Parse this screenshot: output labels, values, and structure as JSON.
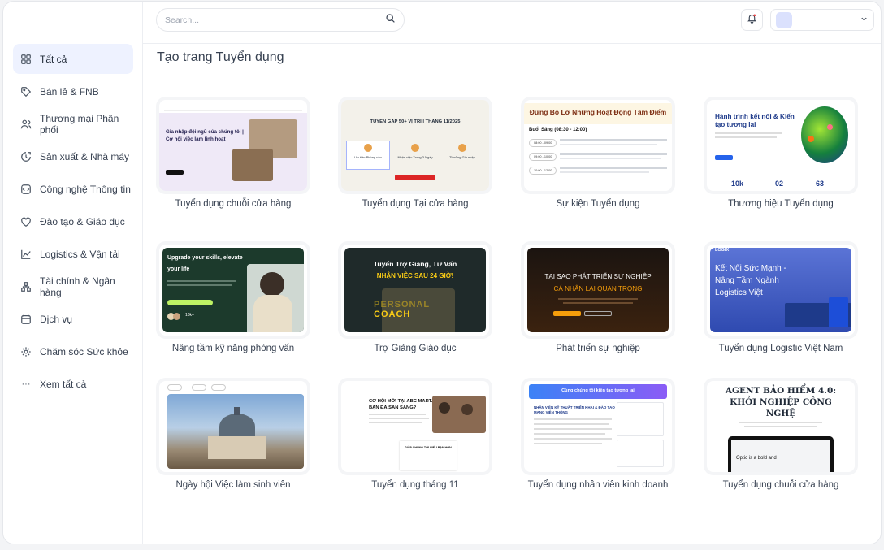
{
  "search": {
    "placeholder": "Search..."
  },
  "sidebar": {
    "items": [
      {
        "label": "Tất cả",
        "icon": "grid-icon",
        "active": true
      },
      {
        "label": "Bán lẻ & FNB",
        "icon": "tag-icon"
      },
      {
        "label": "Thương mại Phân phối",
        "icon": "users-icon"
      },
      {
        "label": "Sản xuất & Nhà máy",
        "icon": "factory-icon"
      },
      {
        "label": "Công nghệ Thông tin",
        "icon": "code-icon"
      },
      {
        "label": "Đào tạo & Giáo dục",
        "icon": "education-icon"
      },
      {
        "label": "Logistics & Vận tải",
        "icon": "chart-icon"
      },
      {
        "label": "Tài chính & Ngân hàng",
        "icon": "bank-icon"
      },
      {
        "label": "Dịch vụ",
        "icon": "calendar-icon"
      },
      {
        "label": "Chăm sóc Sức khỏe",
        "icon": "health-icon"
      },
      {
        "label": "Xem tất cả",
        "icon": "more-icon"
      }
    ]
  },
  "page": {
    "title": "Tạo trang Tuyển dụng"
  },
  "templates": [
    {
      "label": "Tuyển dụng chuỗi cửa hàng",
      "thumb": {
        "bg": "#ffffff",
        "lines": [
          "Gia nhập đội ngũ của chúng tôi |",
          "Cơ hội việc làm linh hoạt"
        ]
      }
    },
    {
      "label": "Tuyển dụng Tại cửa hàng",
      "thumb": {
        "bg": "#f3f1ea",
        "lines": [
          "TUYỂN GẤP 50+ VỊ TRÍ | THÁNG 11/2025",
          "Ưu tiên Phòng vân",
          "Nhận việc Trong 3 Ngày",
          "Thưởng Gia nhập"
        ]
      }
    },
    {
      "label": "Sự kiện Tuyển dụng",
      "thumb": {
        "bg": "#ffffff",
        "lines": [
          "Đừng Bỏ Lỡ Những Hoạt Động Tâm Điểm",
          "Buổi Sáng (08:30 - 12:00)",
          "08:00 - 09:00",
          "09:00 - 10:00",
          "10:00 - 12:00"
        ]
      }
    },
    {
      "label": "Thương hiệu Tuyển dụng",
      "thumb": {
        "bg": "#ffffff",
        "lines": [
          "Hành trình kết nối & Kiến",
          "tạo tương lai",
          "10k",
          "02",
          "63"
        ]
      }
    },
    {
      "label": "Nâng tầm kỹ năng phỏng vấn",
      "thumb": {
        "bg": "#1c3a2c",
        "lines": [
          "Upgrade your skills, elevate",
          "your life",
          "10k+"
        ]
      }
    },
    {
      "label": "Trợ Giảng Giáo dục",
      "thumb": {
        "bg": "#1f2a2a",
        "lines": [
          "Tuyển Trợ Giảng, Tư Vấn",
          "NHẬN VIỆC SAU 24 GIỜ!",
          "PERSONAL",
          "COACH"
        ]
      }
    },
    {
      "label": "Phát triển sự nghiệp",
      "thumb": {
        "bg": "#1b1410",
        "lines": [
          "TẠI SAO PHÁT TRIỂN SỰ NGHIỆP",
          "CÁ NHÂN LẠI QUAN TRỌNG"
        ]
      }
    },
    {
      "label": "Tuyển dụng Logistic Việt Nam",
      "thumb": {
        "bg": "#3f5cc9",
        "lines": [
          "Kết Nối Sức Mạnh -",
          "Nâng Tầm Ngành",
          "Logistics Việt",
          "LOGIX"
        ]
      }
    },
    {
      "label": "Ngày hội Việc làm sinh viên",
      "thumb": {
        "bg": "#8fb3d9",
        "lines": []
      }
    },
    {
      "label": "Tuyển dụng tháng 11",
      "thumb": {
        "bg": "#ffffff",
        "lines": [
          "CƠ HỘI MỚI TẠI ABC MART.",
          "BẠN ĐÃ SẴN SÀNG?",
          "GIẢP CHUNG TỚI HIẾU BẠN HƠN"
        ]
      }
    },
    {
      "label": "Tuyển dụng nhân viên kinh doanh",
      "thumb": {
        "bg": "#ffffff",
        "lines": [
          "Cùng chúng tôi kiến tạo tương lai",
          "NHÂN VIÊN KỸ THUẬT TRIỂN KHAI & ĐÀO TẠO",
          "MẠNG VIỄN THÔNG"
        ]
      }
    },
    {
      "label": "Tuyển dụng chuỗi cửa hàng",
      "thumb": {
        "bg": "#ffffff",
        "lines": [
          "AGENT BẢO HIỂM 4.0:",
          "KHỞI NGHIỆP CÔNG",
          "NGHỆ",
          "Optic is a bold and"
        ]
      }
    }
  ]
}
